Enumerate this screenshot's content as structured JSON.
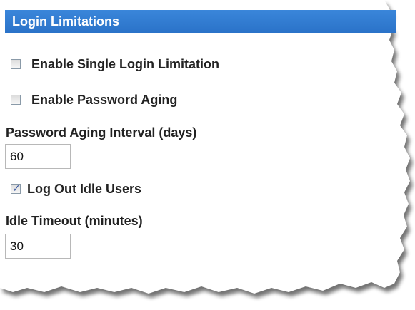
{
  "section": {
    "title": "Login Limitations"
  },
  "options": {
    "single_login": {
      "label": "Enable Single Login Limitation",
      "checked": false
    },
    "password_aging": {
      "label": "Enable Password Aging",
      "checked": false
    },
    "logout_idle": {
      "label": "Log Out Idle Users",
      "checked": true
    }
  },
  "fields": {
    "password_aging_interval": {
      "label": "Password Aging Interval (days)",
      "value": "60"
    },
    "idle_timeout": {
      "label": "Idle Timeout (minutes)",
      "value": "30"
    }
  },
  "icons": {
    "check": "✓"
  },
  "colors": {
    "header_bg": "#2f7bd3",
    "header_text": "#ffffff",
    "label_text": "#222222"
  }
}
